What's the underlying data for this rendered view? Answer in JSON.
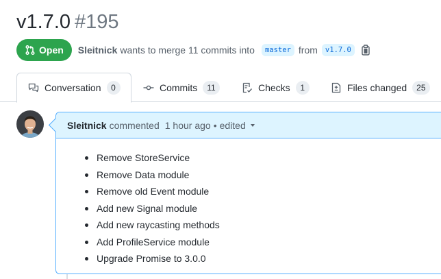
{
  "pr": {
    "title": "v1.7.0",
    "number": "#195",
    "state": "Open",
    "author": "Sleitnick",
    "merge_text": "wants to merge 11 commits into",
    "base_branch": "master",
    "from_text": "from",
    "head_branch": "v1.7.0"
  },
  "tabs": [
    {
      "label": "Conversation",
      "count": "0",
      "icon": "comment-discussion-icon"
    },
    {
      "label": "Commits",
      "count": "11",
      "icon": "git-commit-icon"
    },
    {
      "label": "Checks",
      "count": "1",
      "icon": "checklist-icon"
    },
    {
      "label": "Files changed",
      "count": "25",
      "icon": "file-diff-icon"
    }
  ],
  "comment": {
    "author": "Sleitnick",
    "action": "commented",
    "time": "1 hour ago",
    "edited": "edited",
    "items": [
      "Remove StoreService",
      "Remove Data module",
      "Remove old Event module",
      "Add new Signal module",
      "Add new raycasting methods",
      "Add ProfileService module",
      "Upgrade Promise to 3.0.0"
    ]
  },
  "colors": {
    "open_green": "#2da44e",
    "link_blue": "#0969da",
    "header_blue": "#ddf4ff",
    "border_blue": "#54aeff"
  }
}
